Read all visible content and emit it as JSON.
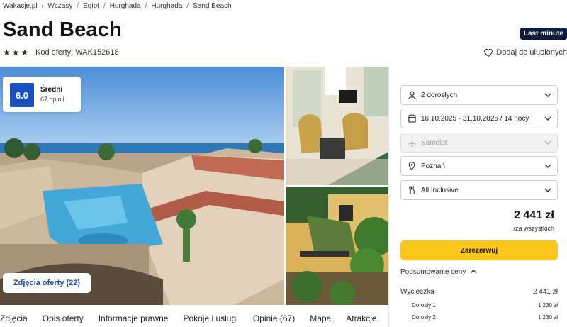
{
  "breadcrumb": [
    "Wakacje.pl",
    "Wczasy",
    "Egipt",
    "Hurghada",
    "Hurghada",
    "Sand Beach"
  ],
  "hotel": {
    "name": "Sand Beach",
    "badge": "Last minute",
    "stars": 3,
    "offer_code": "Kod oferty: WAK152618",
    "favorite_label": "Dodaj do ulubionych"
  },
  "rating": {
    "score": "6.0",
    "label": "Średni",
    "count": "67 opinii"
  },
  "gallery": {
    "photos_button": "Zdjęcia oferty (22)"
  },
  "booking": {
    "travelers": "2 dorosłych",
    "dates": "16.10.2025 - 31.10.2025 / 14 nocy",
    "transport": "Samolot",
    "departure": "Poznań",
    "board": "All Inclusive",
    "price": "2 441 zł",
    "price_note": "/za wszystkich",
    "reserve_label": "Zarezerwuj",
    "summary_label": "Podsumowanie ceny",
    "summary": {
      "trip_label": "Wycieczka",
      "trip_value": "2 441 zł",
      "rows": [
        {
          "label": "Dorosły 1",
          "value": "1 230 zł"
        },
        {
          "label": "Dorosły 2",
          "value": "1 230 zł"
        }
      ]
    }
  },
  "tabs": [
    "Zdjęcia",
    "Opis oferty",
    "Informacje prawne",
    "Pokoje i usługi",
    "Opinie (67)",
    "Mapa",
    "Atrakcje"
  ],
  "colors": {
    "accent_blue": "#1a4fbf",
    "reserve_yellow": "#fcc61a",
    "badge_navy": "#0d1b3d"
  }
}
